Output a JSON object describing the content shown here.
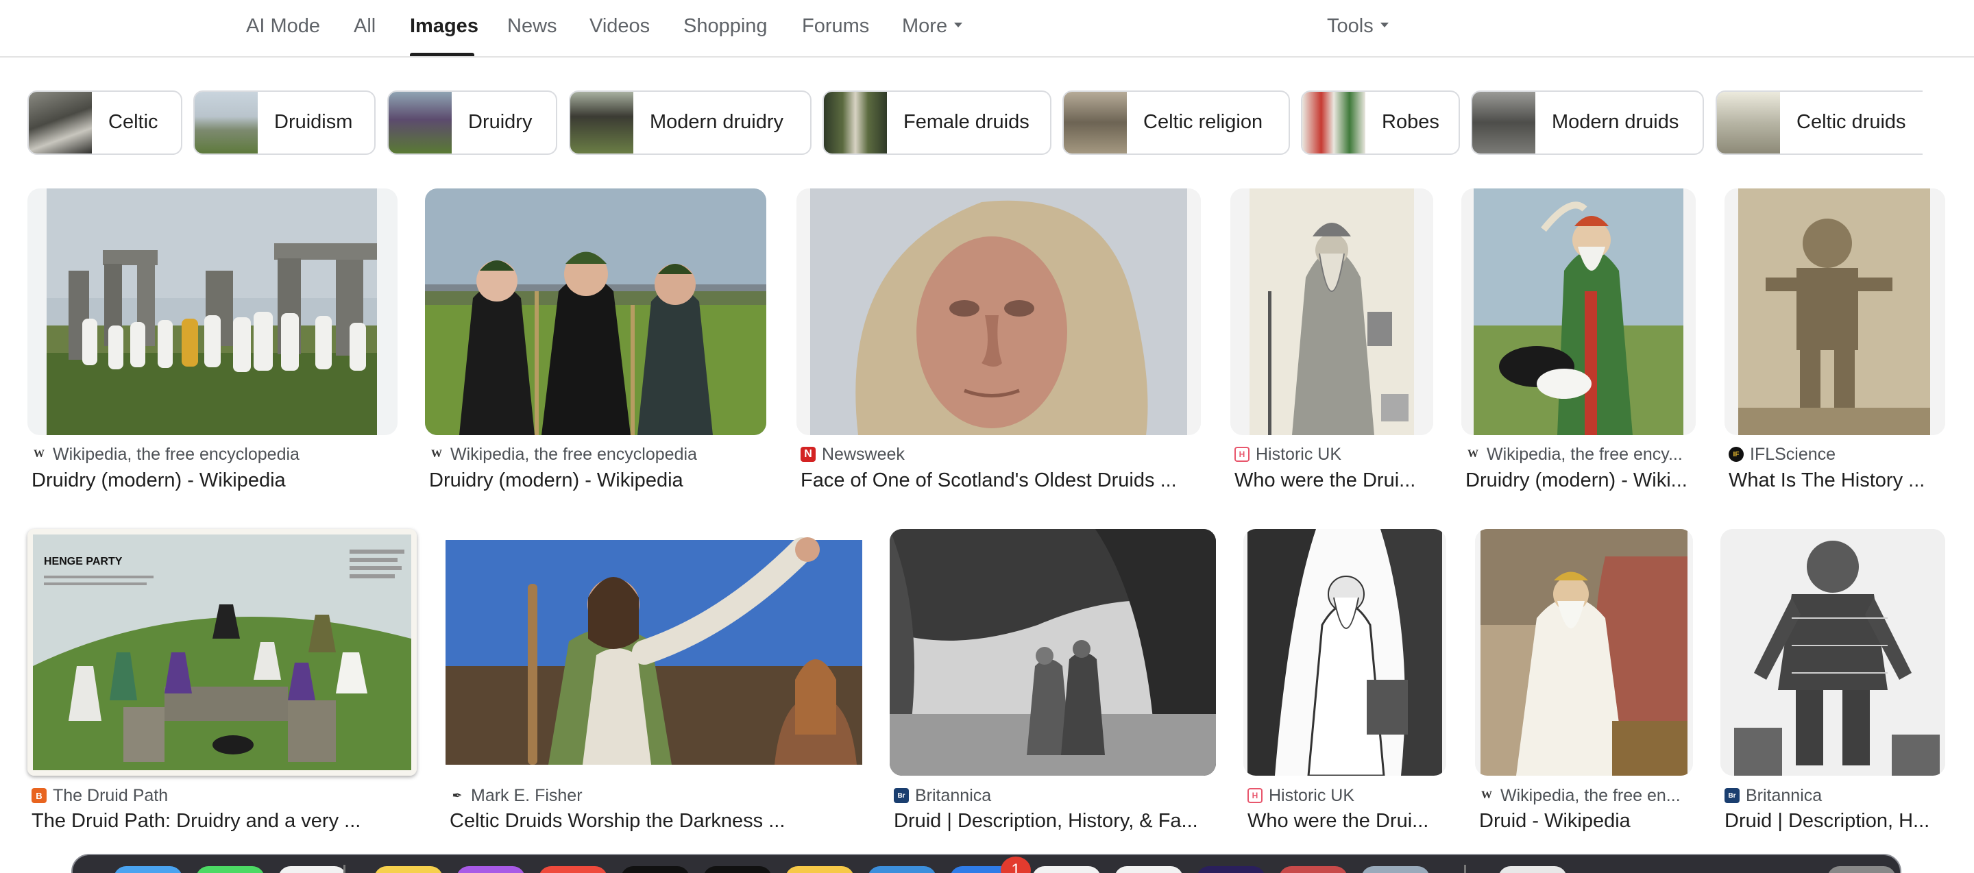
{
  "tabs": [
    {
      "label": "AI Mode"
    },
    {
      "label": "All"
    },
    {
      "label": "Images",
      "active": true
    },
    {
      "label": "News"
    },
    {
      "label": "Videos"
    },
    {
      "label": "Shopping"
    },
    {
      "label": "Forums"
    },
    {
      "label": "More"
    }
  ],
  "tools_label": "Tools",
  "chips": [
    {
      "label": "Celtic"
    },
    {
      "label": "Druidism"
    },
    {
      "label": "Druidry"
    },
    {
      "label": "Modern druidry"
    },
    {
      "label": "Female druids"
    },
    {
      "label": "Celtic religion"
    },
    {
      "label": "Robes"
    },
    {
      "label": "Modern druids"
    },
    {
      "label": "Celtic druids"
    }
  ],
  "results": [
    {
      "source": "Wikipedia, the free encyclopedia",
      "title": "Druidry (modern) - Wikipedia",
      "favicon": "W"
    },
    {
      "source": "Wikipedia, the free encyclopedia",
      "title": "Druidry (modern) - Wikipedia",
      "favicon": "W"
    },
    {
      "source": "Newsweek",
      "title": "Face of One of Scotland's Oldest Druids ...",
      "favicon": "N"
    },
    {
      "source": "Historic UK",
      "title": "Who were the Drui...",
      "favicon": "H"
    },
    {
      "source": "Wikipedia, the free ency...",
      "title": "Druidry (modern) - Wiki...",
      "favicon": "W"
    },
    {
      "source": "IFLScience",
      "title": "What Is The History ...",
      "favicon": "IF"
    },
    {
      "source": "The Druid Path",
      "title": "The Druid Path: Druidry and a very ...",
      "favicon": "B"
    },
    {
      "source": "Mark E. Fisher",
      "title": "Celtic Druids Worship the Darkness ...",
      "favicon": "pen"
    },
    {
      "source": "Britannica",
      "title": "Druid | Description, History, & Fa...",
      "favicon": "Br"
    },
    {
      "source": "Historic UK",
      "title": "Who were the Drui...",
      "favicon": "H"
    },
    {
      "source": "Wikipedia, the free en...",
      "title": "Druid - Wikipedia",
      "favicon": "W"
    },
    {
      "source": "Britannica",
      "title": "Druid | Description, H...",
      "favicon": "Br"
    }
  ],
  "featured_image_text": {
    "heading": "HENGE PARTY"
  },
  "dock": {
    "notification_badge": "1"
  },
  "colors": {
    "active_tab": "#1f1f1f",
    "inactive_tab": "#5f6368",
    "chip_border": "#dadce0",
    "source_text": "#4d5156",
    "newsweek_red": "#d32323",
    "historic_uk_pink": "#e8566c",
    "britannica_blue": "#1a3e6f",
    "druid_path_orange": "#e8641f"
  }
}
